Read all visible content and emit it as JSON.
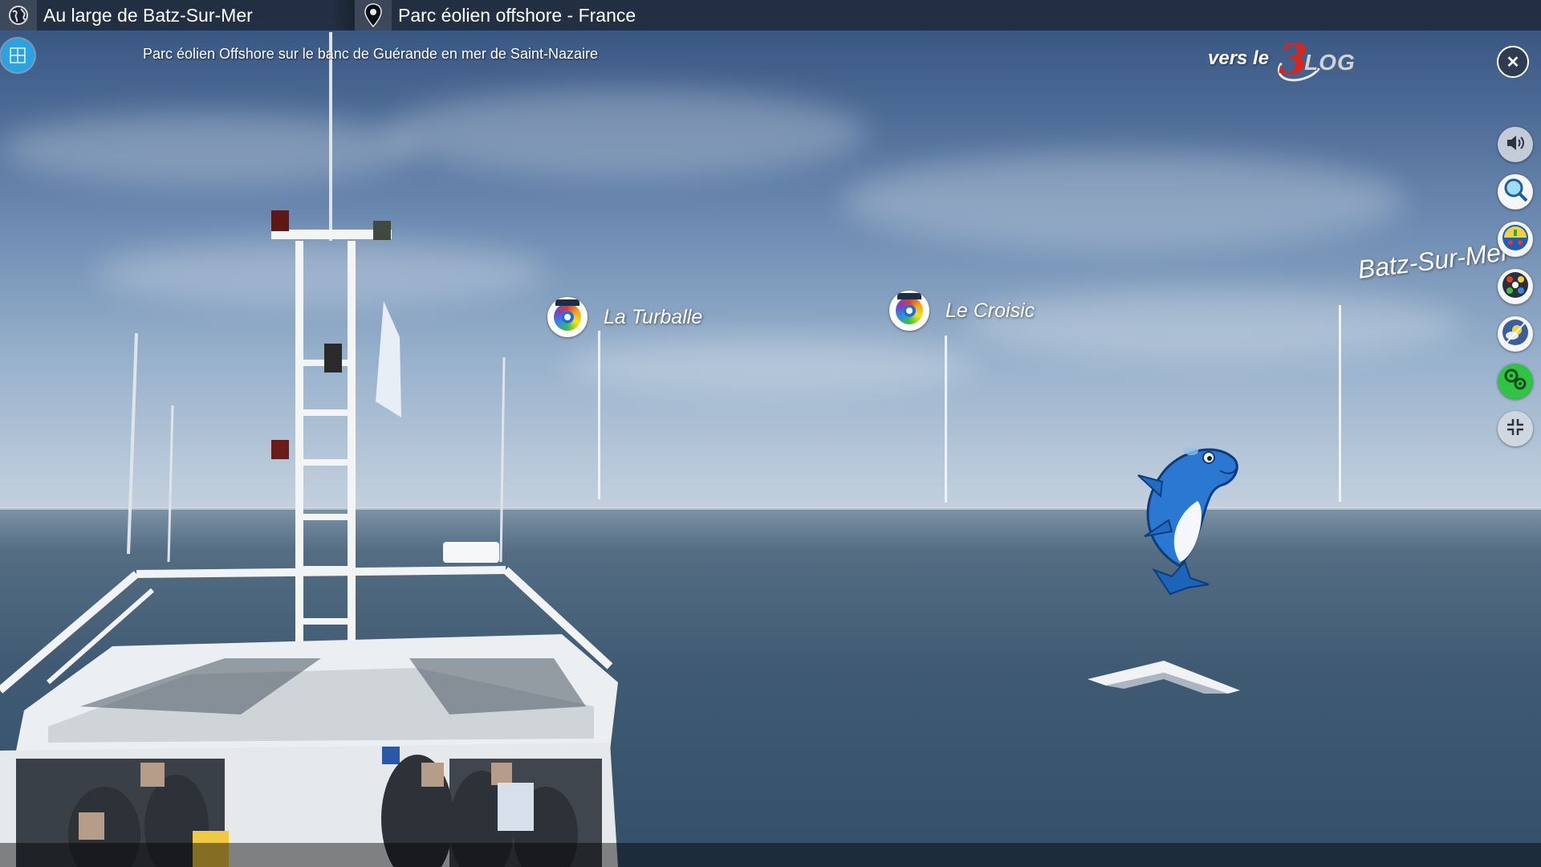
{
  "header": {
    "location_title": "Au large de Batz-Sur-Mer",
    "place_title": "Parc éolien offshore - France",
    "location_icon": "globe-icon",
    "place_icon": "map-pin-icon"
  },
  "subheader": {
    "info_icon": "info-icon",
    "description": "Parc éolien Offshore sur le banc de Guérande en mer de Saint-Nazaire"
  },
  "blog_link": {
    "prefix": "vers le",
    "logo_number": "3",
    "logo_text": "LOG"
  },
  "close": {
    "icon": "close-icon",
    "symbol": "✕"
  },
  "hotspots": [
    {
      "label": "La Turballe",
      "icon": "target-icon"
    },
    {
      "label": "Le Croisic",
      "icon": "target-icon"
    },
    {
      "label": "Batz-Sur-Mer"
    }
  ],
  "toolbar": [
    {
      "name": "sound",
      "icon": "speaker-icon",
      "symbol": "🔊"
    },
    {
      "name": "search",
      "icon": "magnifier-icon"
    },
    {
      "name": "map",
      "icon": "map-icon"
    },
    {
      "name": "panoramas",
      "icon": "gallery-icon"
    },
    {
      "name": "weather",
      "icon": "weather-icon"
    },
    {
      "name": "options",
      "icon": "gears-icon"
    },
    {
      "name": "exit-fullscreen",
      "icon": "exit-fullscreen-icon"
    }
  ],
  "mascot": {
    "icon": "dolphin-icon"
  },
  "navigation": {
    "icon": "forward-arrow-icon"
  }
}
